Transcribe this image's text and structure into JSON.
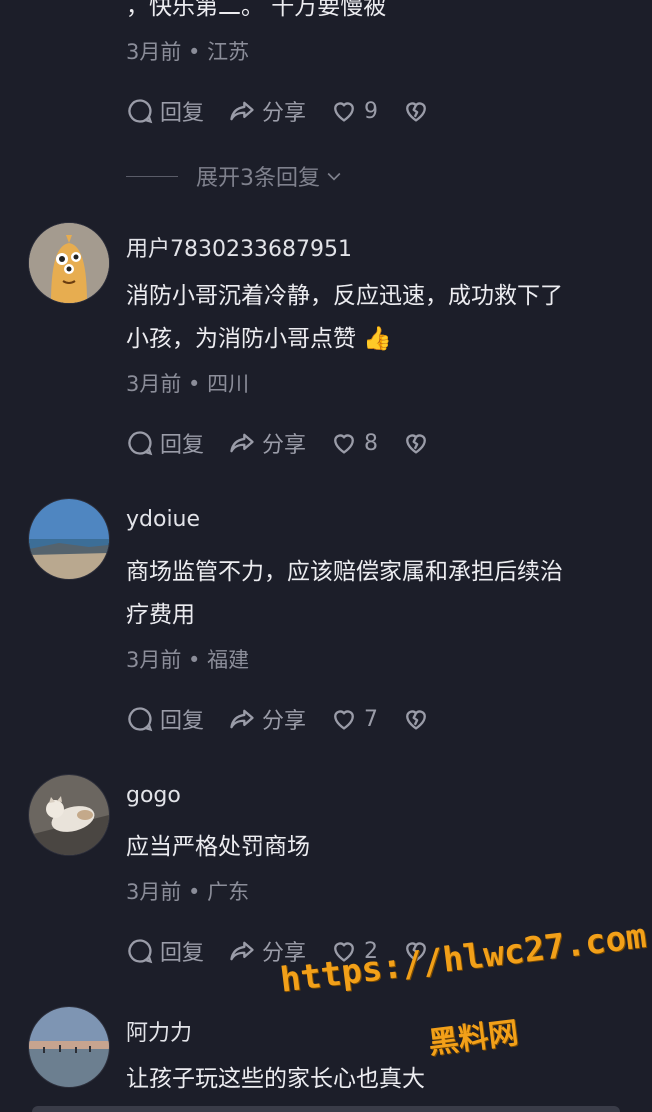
{
  "top_comment": {
    "partial_text": "，快乐第二。 千万要慢被",
    "meta": "3月前 • 江苏",
    "actions": {
      "reply": "回复",
      "share": "分享",
      "likes": "9"
    },
    "expand_label": "展开3条回复"
  },
  "comments": [
    {
      "username": "用户7830233687951",
      "text_line1": "消防小哥沉着冷静，反应迅速，成功救下了",
      "text_line2": "小孩，为消防小哥点赞",
      "emoji": "👍",
      "meta": "3月前 • 四川",
      "actions": {
        "reply": "回复",
        "share": "分享",
        "likes": "8"
      },
      "avatar_icon": "cartoon-avatar-icon"
    },
    {
      "username": "ydoiue",
      "text_line1": "商场监管不力，应该赔偿家属和承担后续治",
      "text_line2": "疗费用",
      "meta": "3月前 • 福建",
      "actions": {
        "reply": "回复",
        "share": "分享",
        "likes": "7"
      },
      "avatar_icon": "seaside-avatar-icon"
    },
    {
      "username": "gogo",
      "text_line1": "应当严格处罚商场",
      "meta": "3月前 • 广东",
      "actions": {
        "reply": "回复",
        "share": "分享",
        "likes": "2"
      },
      "avatar_icon": "cat-avatar-icon"
    },
    {
      "username": "阿力力",
      "text_line1": "让孩子玩这些的家长心也真大",
      "avatar_icon": "beach-avatar-icon"
    }
  ],
  "watermark": {
    "url": "https://hlwc27.com",
    "label": "黑料网"
  },
  "colors": {
    "background": "#1c1e29",
    "text": "#ececf0",
    "muted": "#8b8d99",
    "watermark": "#f2a019"
  }
}
